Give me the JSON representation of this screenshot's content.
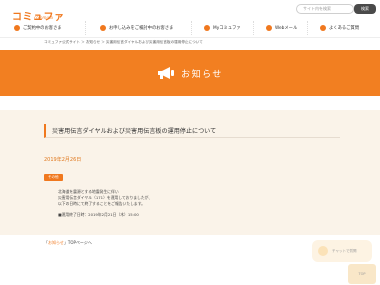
{
  "header": {
    "logo_main": "コミュファ",
    "logo_sub": "commufa",
    "search_placeholder": "サイト内を検索",
    "search_button": "検索"
  },
  "nav": {
    "items": [
      {
        "label": "ご契約中のお客さま",
        "icon": "person-icon"
      },
      {
        "label": "お申し込みをご検討中のお客さま",
        "icon": "document-icon"
      },
      {
        "label": "Myコミュファ",
        "icon": "heart-icon"
      },
      {
        "label": "Webメール",
        "icon": "mail-icon"
      },
      {
        "label": "よくあるご質問",
        "icon": "question-icon"
      }
    ]
  },
  "breadcrumb": "コミュファ公式サイト ＞ お知らせ ＞ 災害用伝言ダイヤルおよび災害用伝言板の運用停止について",
  "banner": {
    "title": "お知らせ",
    "icon": "megaphone-icon",
    "color": "#f27f21"
  },
  "article": {
    "title": "災害用伝言ダイヤルおよび災害用伝言板の運用停止について",
    "date": "2019年2月26日",
    "badge": "その他",
    "lines": [
      "北海道を震源とする地震発生に伴い",
      "災害用伝言ダイヤル（171）を運用しておりましたが、",
      "以下の日時にて終了することをご報告いたします。"
    ],
    "end_note": "■運用終了日時：2019年2月21日（木）15:00"
  },
  "footer": {
    "back_link_quote_open": "「",
    "back_link_label": "お知らせ",
    "back_link_suffix": "」TOPページへ",
    "chat_text": "チャットで質問",
    "scroll_top": "TOP"
  },
  "colors": {
    "accent": "#f0781e",
    "main_bg": "#faf3e9"
  }
}
